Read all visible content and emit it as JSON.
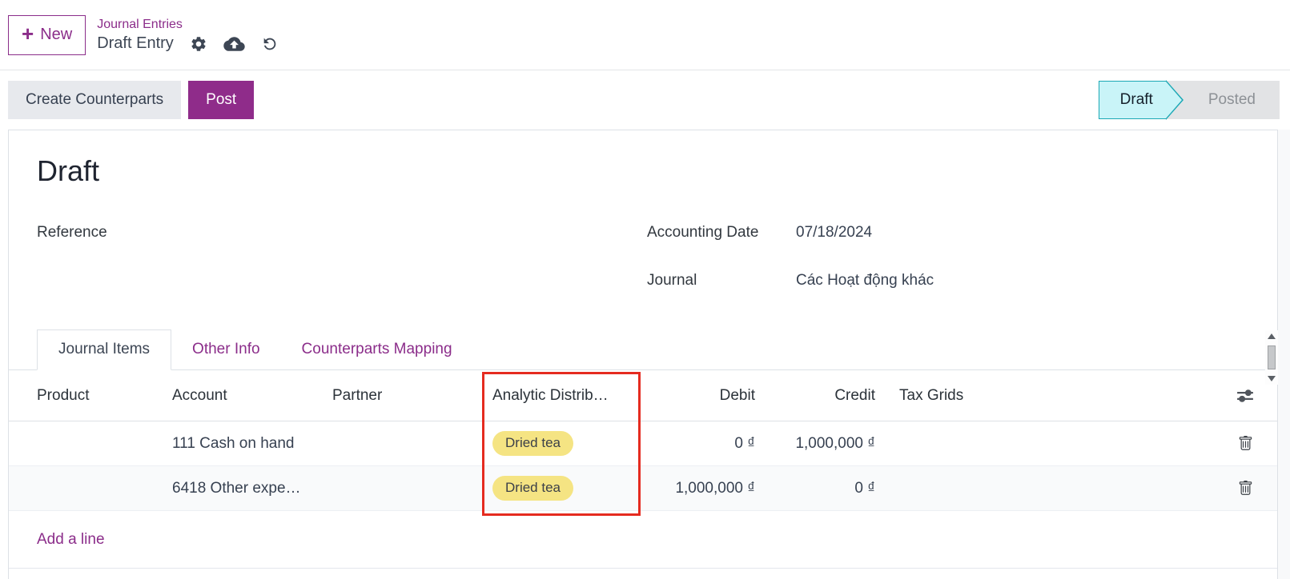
{
  "header": {
    "new_button": "New",
    "breadcrumb": {
      "parent": "Journal Entries",
      "current": "Draft Entry"
    }
  },
  "toolbar": {
    "create_counterparts_label": "Create Counterparts",
    "post_label": "Post"
  },
  "statusbar": {
    "draft": "Draft",
    "posted": "Posted"
  },
  "form": {
    "title": "Draft",
    "reference_label": "Reference",
    "reference_value": "",
    "accounting_date_label": "Accounting Date",
    "accounting_date_value": "07/18/2024",
    "journal_label": "Journal",
    "journal_value": "Các Hoạt động khác"
  },
  "tabs": [
    {
      "label": "Journal Items",
      "active": true
    },
    {
      "label": "Other Info",
      "active": false
    },
    {
      "label": "Counterparts Mapping",
      "active": false
    }
  ],
  "table": {
    "columns": {
      "product": "Product",
      "account": "Account",
      "partner": "Partner",
      "analytic": "Analytic Distrib…",
      "debit": "Debit",
      "credit": "Credit",
      "tax_grids": "Tax Grids"
    },
    "rows": [
      {
        "product": "",
        "account": "111 Cash on hand",
        "partner": "",
        "analytic_tag": "Dried tea",
        "debit": "0 ₫",
        "credit": "1,000,000 ₫",
        "tax_grids": ""
      },
      {
        "product": "",
        "account": "6418 Other expe…",
        "partner": "",
        "analytic_tag": "Dried tea",
        "debit": "1,000,000 ₫",
        "credit": "0 ₫",
        "tax_grids": ""
      }
    ],
    "add_line_label": "Add a line"
  },
  "annotation": {
    "target": "Analytic Distribution column",
    "color": "#e52b20"
  },
  "icons": {
    "plus": "+",
    "gear": "gear-icon",
    "cloud_upload": "cloud-upload-icon",
    "undo": "undo-icon",
    "adjustments": "column-adjustments-icon",
    "trash": "trash-icon"
  },
  "colors": {
    "accent_purple": "#8b2d8a",
    "post_button_bg": "#8f2c8a",
    "secondary_button_bg": "#e7e9ed",
    "status_draft_bg": "#c9f4f8",
    "status_draft_border": "#1ba8b5",
    "status_posted_bg": "#e2e3e5",
    "tag_yellow_bg": "#f5e483",
    "annotation_red": "#e52b20"
  }
}
